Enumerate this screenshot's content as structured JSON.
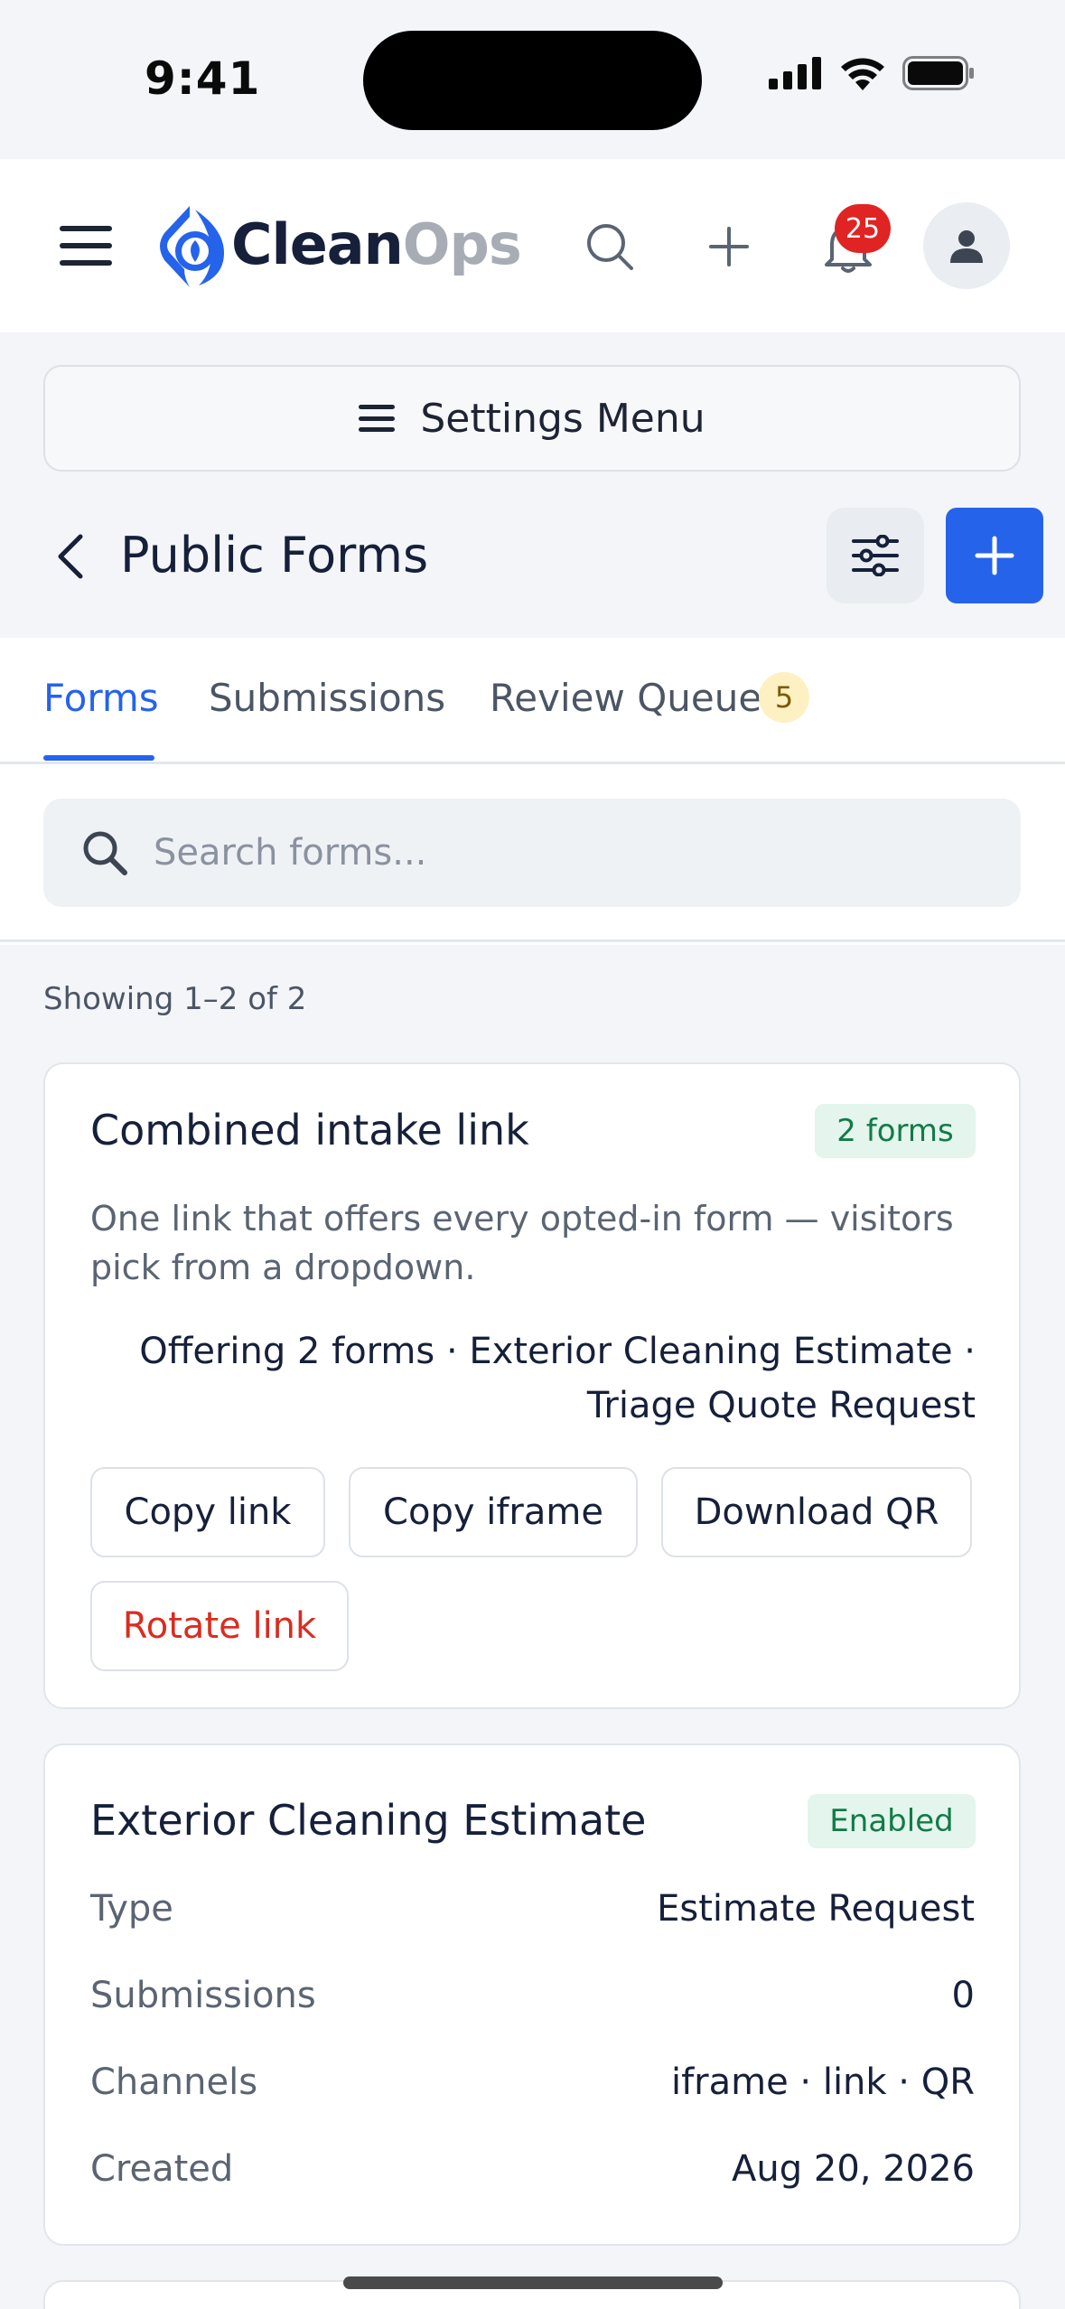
{
  "status_bar": {
    "time": "9:41"
  },
  "nav": {
    "logo_part1": "Clean",
    "logo_part2": "Ops",
    "notification_count": "25"
  },
  "settings_menu": {
    "label": "Settings Menu"
  },
  "page": {
    "title": "Public Forms"
  },
  "tabs": [
    {
      "label": "Forms",
      "active": true
    },
    {
      "label": "Submissions",
      "active": false
    },
    {
      "label": "Review Queue",
      "active": false,
      "count": "5"
    }
  ],
  "search": {
    "placeholder": "Search forms..."
  },
  "showing": "Showing 1–2 of 2",
  "combined_card": {
    "title": "Combined intake link",
    "badge": "2 forms",
    "description": "One link that offers every opted-in form — visitors pick from a dropdown.",
    "offering_line1": "Offering 2 forms · Exterior Cleaning Estimate ·",
    "offering_line2": "Triage Quote Request",
    "buttons": {
      "copy_link": "Copy link",
      "copy_iframe": "Copy iframe",
      "download_qr": "Download QR",
      "rotate_link": "Rotate link"
    }
  },
  "form_card": {
    "title": "Exterior Cleaning Estimate",
    "status": "Enabled",
    "rows": [
      {
        "label": "Type",
        "value": "Estimate Request"
      },
      {
        "label": "Submissions",
        "value": "0"
      },
      {
        "label": "Channels",
        "value": "iframe · link · QR"
      },
      {
        "label": "Created",
        "value": "Aug 20, 2026"
      }
    ]
  },
  "colors": {
    "accent": "#2563eb",
    "danger": "#d92d20",
    "success_bg": "#e3f5ec",
    "success_text": "#137a48",
    "badge_red": "#e02424",
    "pending_bg": "#fdf0c2"
  }
}
